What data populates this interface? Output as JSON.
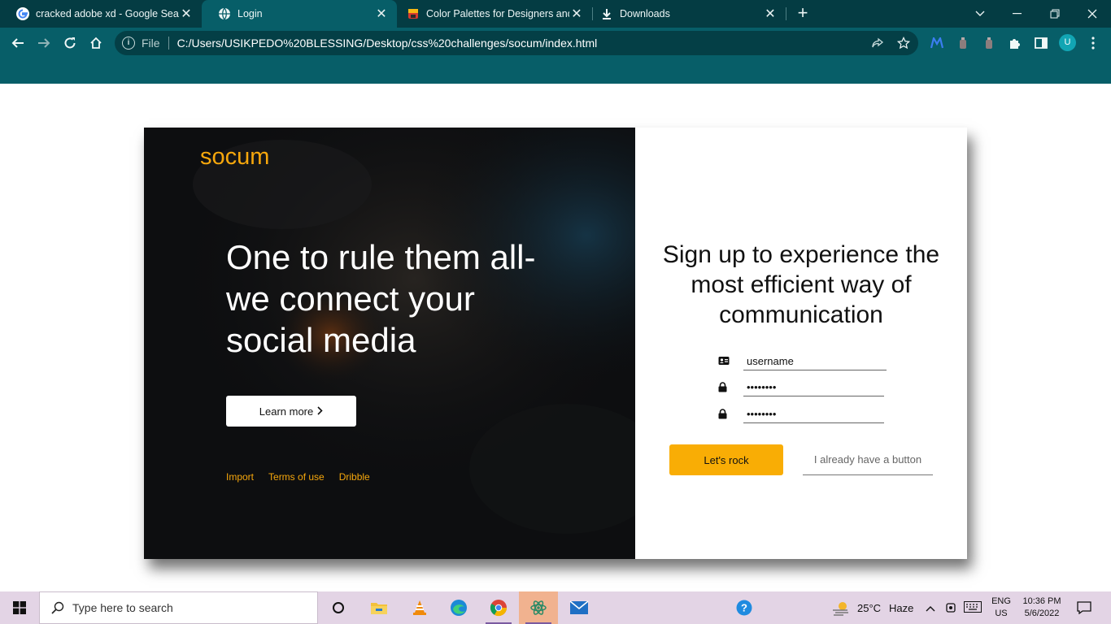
{
  "browser": {
    "tabs": [
      {
        "title": "cracked adobe xd - Google Search",
        "favicon": "google-icon",
        "active": false
      },
      {
        "title": "Login",
        "favicon": "globe-icon",
        "active": true
      },
      {
        "title": "Color Palettes for Designers and Artists",
        "favicon": "palette-icon",
        "active": false
      },
      {
        "title": "Downloads",
        "favicon": "download-icon",
        "active": false
      }
    ],
    "scheme": "File",
    "url": "C:/Users/USIKPEDO%20BLESSING/Desktop/css%20challenges/socum/index.html",
    "profile_initial": "U"
  },
  "page": {
    "brand": "socum",
    "hero": [
      "One to rule them all-",
      "we connect your",
      "social media"
    ],
    "learn_more": "Learn more",
    "footer_links": [
      "Import",
      "Terms of use",
      "Dribble"
    ],
    "signup_heading": [
      "Sign up to experience the",
      "most efficient way of",
      "communication"
    ],
    "fields": [
      {
        "icon": "id-card-icon",
        "value": "username"
      },
      {
        "icon": "lock-icon",
        "value": "••••••••"
      },
      {
        "icon": "lock-icon",
        "value": "••••••••"
      }
    ],
    "primary_button": "Let's rock",
    "secondary_button": "I already have a button",
    "colors": {
      "accent": "#f9ad05",
      "panel": "#0d0e10"
    }
  },
  "taskbar": {
    "search_placeholder": "Type here to search",
    "weather_temp": "25°C",
    "weather_text": "Haze",
    "lang": "ENG",
    "region": "US",
    "time": "10:36 PM",
    "date": "5/6/2022"
  }
}
